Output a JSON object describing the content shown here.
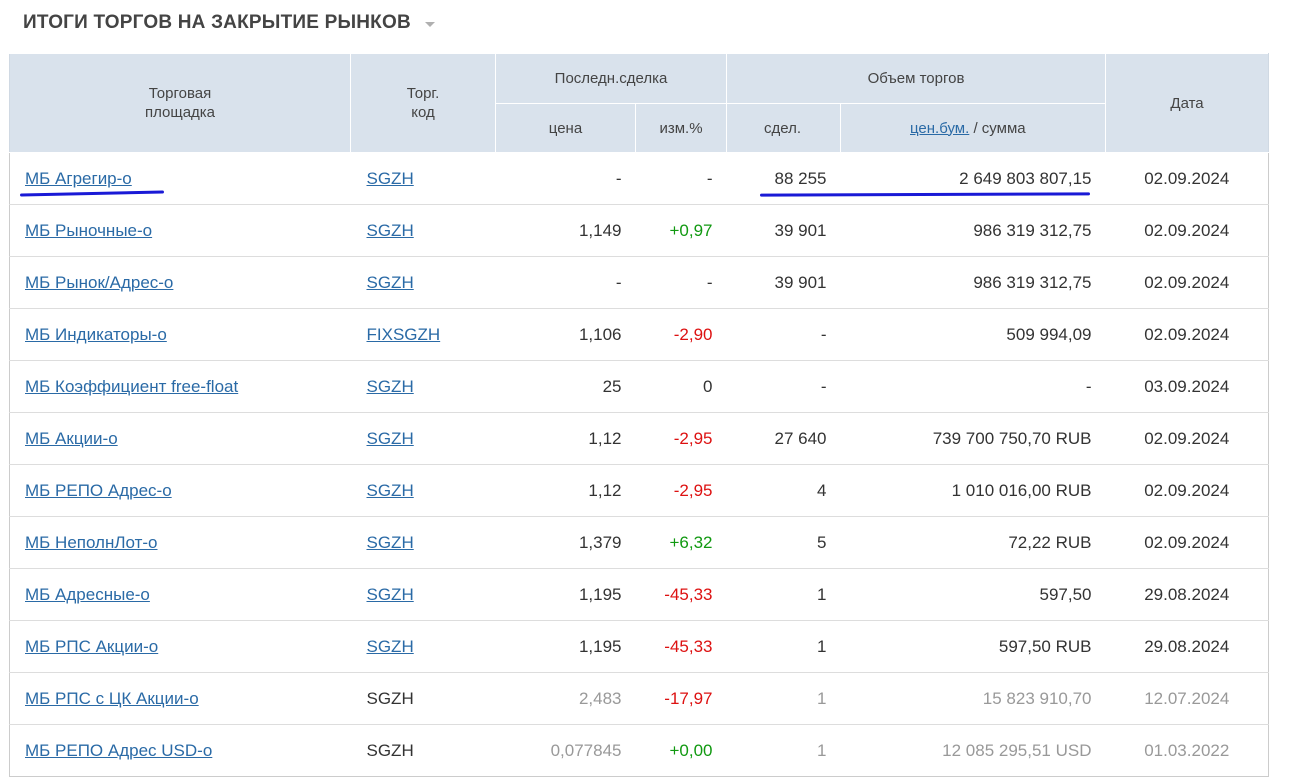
{
  "heading": {
    "title": "ИТОГИ ТОРГОВ НА ЗАКРЫТИЕ РЫНКОВ"
  },
  "table": {
    "headers": {
      "platform": "Торговая площадка",
      "code": "Торг. код",
      "last_trade": "Последн.сделка",
      "price": "цена",
      "change": "изм.%",
      "volume": "Объем торгов",
      "deals": "сдел.",
      "securities_link": "цен.бум.",
      "sum_suffix": "/ сумма",
      "date": "Дата"
    },
    "rows": [
      {
        "platform": "МБ Агрегир-о",
        "code": "SGZH",
        "code_link": true,
        "price": "-",
        "change": "-",
        "change_color": "neutral",
        "deals": "88 255",
        "volume": "2 649 803 807,15",
        "date": "02.09.2024",
        "muted": false
      },
      {
        "platform": "МБ Рыночные-о",
        "code": "SGZH",
        "code_link": true,
        "price": "1,149",
        "change": "+0,97",
        "change_color": "positive",
        "deals": "39 901",
        "volume": "986 319 312,75",
        "date": "02.09.2024",
        "muted": false
      },
      {
        "platform": "МБ Рынок/Адрес-о",
        "code": "SGZH",
        "code_link": true,
        "price": "-",
        "change": "-",
        "change_color": "neutral",
        "deals": "39 901",
        "volume": "986 319 312,75",
        "date": "02.09.2024",
        "muted": false
      },
      {
        "platform": "МБ Индикаторы-о",
        "code": "FIXSGZH",
        "code_link": true,
        "price": "1,106",
        "change": "-2,90",
        "change_color": "negative",
        "deals": "-",
        "volume": "509 994,09",
        "date": "02.09.2024",
        "muted": false
      },
      {
        "platform": "МБ Коэффициент free-float",
        "code": "SGZH",
        "code_link": true,
        "price": "25",
        "change": "0",
        "change_color": "neutral",
        "deals": "-",
        "volume": "-",
        "date": "03.09.2024",
        "muted": false
      },
      {
        "platform": "МБ Акции-о",
        "code": "SGZH",
        "code_link": true,
        "price": "1,12",
        "change": "-2,95",
        "change_color": "negative",
        "deals": "27 640",
        "volume": "739 700 750,70 RUB",
        "date": "02.09.2024",
        "muted": false
      },
      {
        "platform": "МБ РЕПО Адрес-о",
        "code": "SGZH",
        "code_link": true,
        "price": "1,12",
        "change": "-2,95",
        "change_color": "negative",
        "deals": "4",
        "volume": "1 010 016,00 RUB",
        "date": "02.09.2024",
        "muted": false
      },
      {
        "platform": "МБ НеполнЛот-о",
        "code": "SGZH",
        "code_link": true,
        "price": "1,379",
        "change": "+6,32",
        "change_color": "positive",
        "deals": "5",
        "volume": "72,22 RUB",
        "date": "02.09.2024",
        "muted": false
      },
      {
        "platform": "МБ Адресные-о",
        "code": "SGZH",
        "code_link": true,
        "price": "1,195",
        "change": "-45,33",
        "change_color": "negative",
        "deals": "1",
        "volume": "597,50",
        "date": "29.08.2024",
        "muted": false
      },
      {
        "platform": "МБ РПС Акции-о",
        "code": "SGZH",
        "code_link": true,
        "price": "1,195",
        "change": "-45,33",
        "change_color": "negative",
        "deals": "1",
        "volume": "597,50 RUB",
        "date": "29.08.2024",
        "muted": false
      },
      {
        "platform": "МБ РПС с ЦК Акции-о",
        "code": "SGZH",
        "code_link": false,
        "price": "2,483",
        "change": "-17,97",
        "change_color": "negative",
        "deals": "1",
        "volume": "15 823 910,70",
        "date": "12.07.2024",
        "muted": true
      },
      {
        "platform": "МБ РЕПО Адрес USD-о",
        "code": "SGZH",
        "code_link": false,
        "price": "0,077845",
        "change": "+0,00",
        "change_color": "positive",
        "deals": "1",
        "volume": "12 085 295,51 USD",
        "date": "01.03.2022",
        "muted": true
      }
    ]
  },
  "colors": {
    "link": "#2a6aa6",
    "header_bg": "#d9e2ec",
    "positive": "#119911",
    "negative": "#dd1111",
    "muted": "#999999",
    "annotation": "#1a1ad6"
  }
}
